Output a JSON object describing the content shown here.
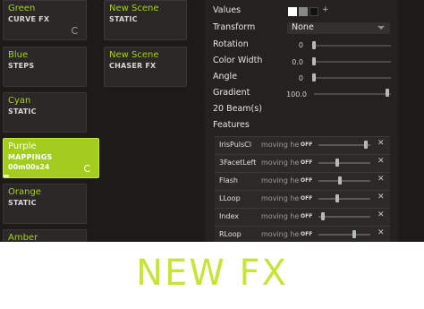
{
  "scenes": {
    "col1": [
      {
        "name": "Green",
        "sub": "CURVE FX",
        "extra": "",
        "loop": true,
        "active": false
      },
      {
        "name": "Blue",
        "sub": "STEPS",
        "extra": "",
        "loop": false,
        "active": false
      },
      {
        "name": "Cyan",
        "sub": "STATIC",
        "extra": "",
        "loop": false,
        "active": false
      },
      {
        "name": "Purple",
        "sub": "MAPPINGS",
        "extra": "00m00s24",
        "loop": true,
        "active": true
      },
      {
        "name": "Orange",
        "sub": "STATIC",
        "extra": "",
        "loop": false,
        "active": false
      },
      {
        "name": "Amber",
        "sub": "",
        "extra": "",
        "loop": false,
        "active": false
      }
    ],
    "col2": [
      {
        "name": "New Scene",
        "sub": "STATIC"
      },
      {
        "name": "New Scene",
        "sub": "CHASER FX"
      }
    ]
  },
  "panel": {
    "values_label": "Values",
    "values_colors": [
      "#ffffff",
      "#888888",
      "#111111"
    ],
    "values_plus": "+",
    "transform_label": "Transform",
    "transform_value": "None",
    "rotation_label": "Rotation",
    "rotation_value": "0",
    "color_width_label": "Color Width",
    "color_width_value": "0.0",
    "angle_label": "Angle",
    "angle_value": "0",
    "gradient_label": "Gradient",
    "gradient_value": "100.0",
    "gradient_level": 1.0,
    "beams_label": "20 Beam(s)",
    "features_label": "Features"
  },
  "features": [
    {
      "name": "IrisPulsCl",
      "type": "moving he...",
      "state": "OFF",
      "level": 0.95
    },
    {
      "name": "3FacetLeft",
      "type": "moving he...",
      "state": "OFF",
      "level": 0.35
    },
    {
      "name": "Flash",
      "type": "moving head",
      "state": "OFF",
      "level": 0.4
    },
    {
      "name": "LLoop",
      "type": "moving head",
      "state": "OFF",
      "level": 0.35
    },
    {
      "name": "Index",
      "type": "moving head",
      "state": "OFF",
      "level": 0.05
    },
    {
      "name": "RLoop",
      "type": "moving head",
      "state": "OFF",
      "level": 0.7
    }
  ],
  "close_glyph": "✕",
  "title": "NEW FX"
}
